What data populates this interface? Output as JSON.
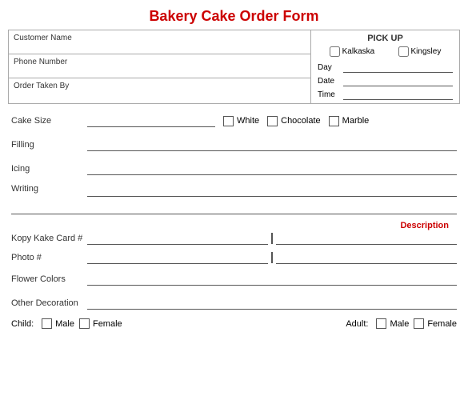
{
  "title": "Bakery Cake Order Form",
  "top_section": {
    "customer_name_label": "Customer Name",
    "phone_number_label": "Phone Number",
    "order_taken_label": "Order Taken By",
    "pickup_title": "PICK UP",
    "location1": "Kalkaska",
    "location2": "Kingsley",
    "day_label": "Day",
    "date_label": "Date",
    "time_label": "Time"
  },
  "form": {
    "cake_size_label": "Cake Size",
    "white_label": "White",
    "chocolate_label": "Chocolate",
    "marble_label": "Marble",
    "filling_label": "Filling",
    "icing_label": "Icing",
    "writing_label": "Writing",
    "description_label": "Description",
    "kopy_kake_label": "Kopy Kake Card #",
    "photo_label": "Photo #",
    "flower_colors_label": "Flower Colors",
    "other_decoration_label": "Other Decoration",
    "child_label": "Child:",
    "male_label": "Male",
    "female_label": "Female",
    "adult_label": "Adult:",
    "adult_male_label": "Male",
    "adult_female_label": "Female"
  }
}
